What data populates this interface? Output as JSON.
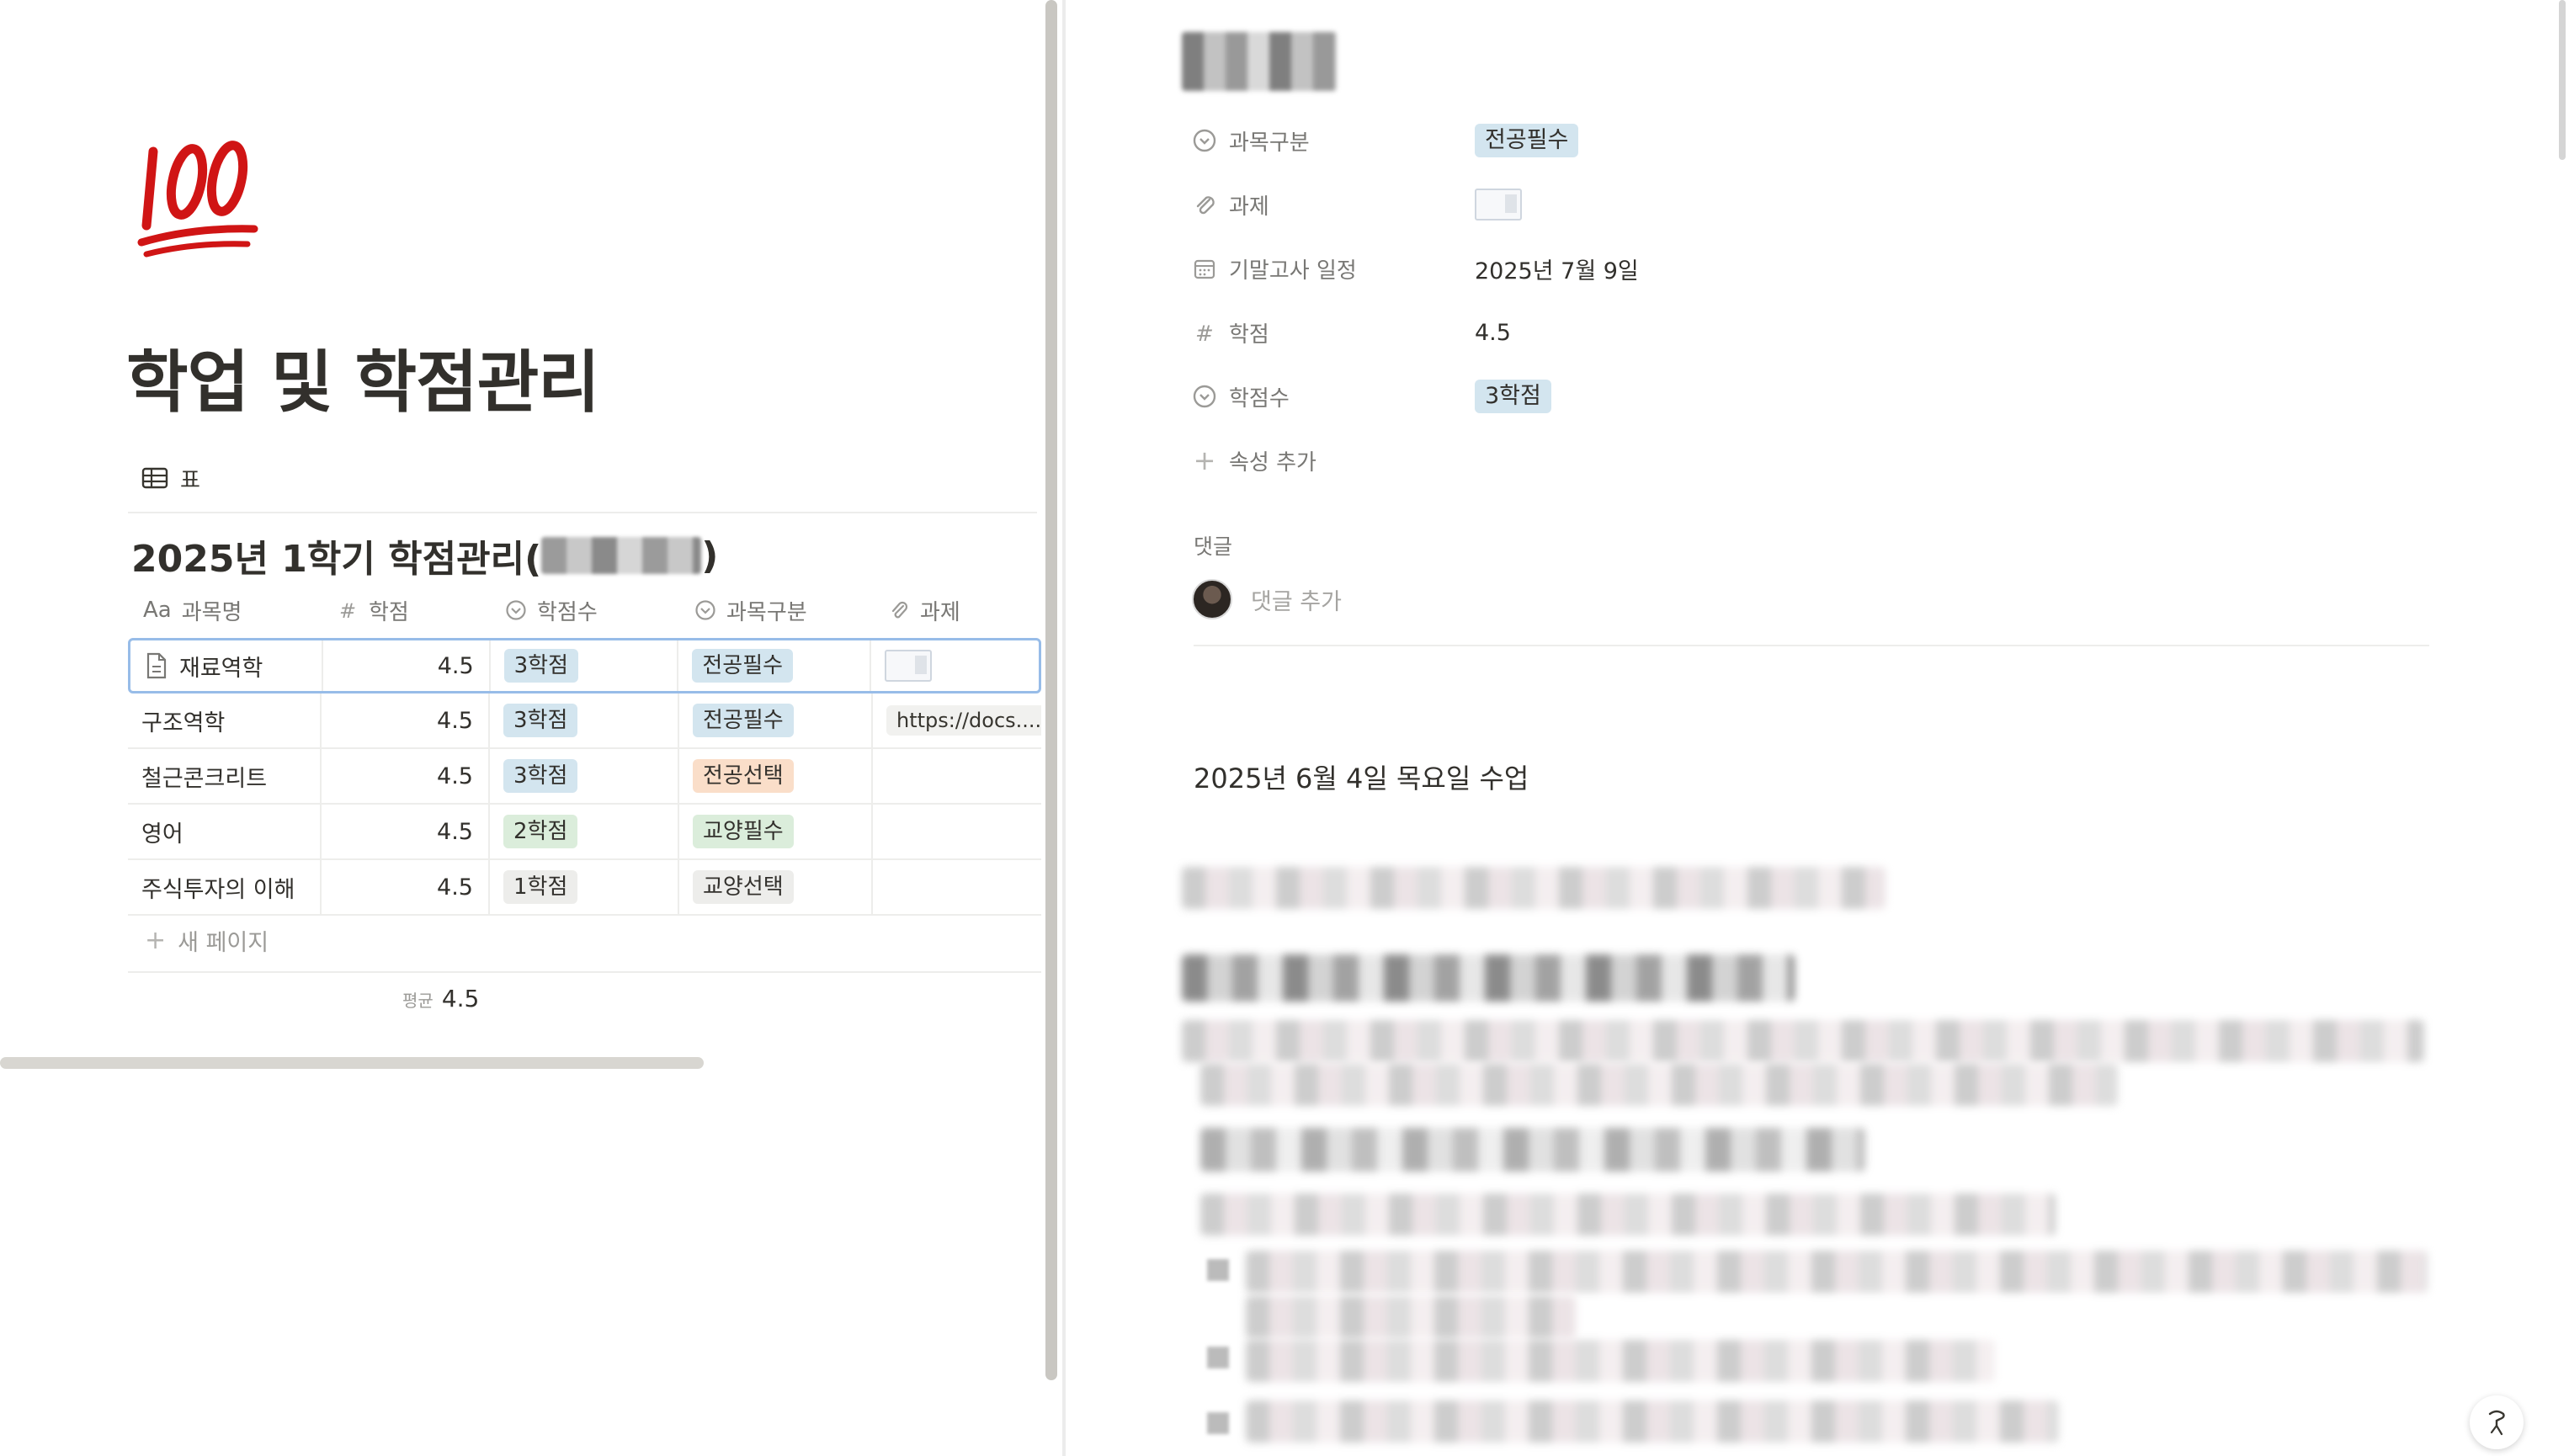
{
  "page": {
    "title": "학업 및 학점관리",
    "view_tab": "표"
  },
  "database": {
    "title": "2025년 1학기 학점관리(",
    "title_end": ")",
    "columns": [
      {
        "label": "과목명",
        "prefix": "Aa"
      },
      {
        "label": "학점"
      },
      {
        "label": "학점수"
      },
      {
        "label": "과목구분"
      },
      {
        "label": "과제"
      }
    ],
    "rows": [
      {
        "name": "재료역학",
        "credit": "4.5",
        "hours": "3학점",
        "type": "전공필수",
        "assignment": "",
        "type_color": "blue",
        "hours_color": "blue"
      },
      {
        "name": "구조역학",
        "credit": "4.5",
        "hours": "3학점",
        "type": "전공필수",
        "assignment": "https://docs....",
        "type_color": "blue",
        "hours_color": "blue"
      },
      {
        "name": "철근콘크리트",
        "credit": "4.5",
        "hours": "3학점",
        "type": "전공선택",
        "assignment": "",
        "type_color": "orange",
        "hours_color": "blue"
      },
      {
        "name": "영어",
        "credit": "4.5",
        "hours": "2학점",
        "type": "교양필수",
        "assignment": "",
        "type_color": "green",
        "hours_color": "green"
      },
      {
        "name": "주식투자의 이해",
        "credit": "4.5",
        "hours": "1학점",
        "type": "교양선택",
        "assignment": "",
        "type_color": "gray",
        "hours_color": "gray"
      }
    ],
    "new_page": "새 페이지",
    "summary_label": "평균",
    "summary_value": "4.5"
  },
  "detail": {
    "properties": [
      {
        "icon": "select-icon",
        "name": "과목구분",
        "value": "전공필수"
      },
      {
        "icon": "paperclip-icon",
        "name": "과제",
        "value": ""
      },
      {
        "icon": "calendar-icon",
        "name": "기말고사 일정",
        "value": "2025년 7월 9일"
      },
      {
        "icon": "number-icon",
        "name": "학점",
        "value": "4.5"
      },
      {
        "icon": "select-icon",
        "name": "학점수",
        "value": "3학점"
      }
    ],
    "add_property": "속성 추가",
    "comments_label": "댓글",
    "comment_placeholder": "댓글 추가",
    "section_heading": "2025년 6월 4일 목요일 수업"
  },
  "colors": {
    "tag_blue": "#d3e5ef",
    "tag_orange": "#fadec9",
    "tag_green": "#dbeddb",
    "tag_gray": "#ededeb",
    "selected_border": "#97bce8"
  }
}
